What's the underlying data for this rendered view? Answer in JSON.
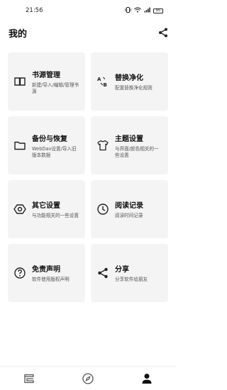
{
  "status_bar": {
    "time": "21:56",
    "battery": "85"
  },
  "header": {
    "title": "我的"
  },
  "cards": [
    {
      "icon": "book-icon",
      "title": "书源管理",
      "desc": "新建/导入/编辑/管理书源"
    },
    {
      "icon": "text-replace-icon",
      "title": "替换净化",
      "desc": "配置替换净化规则"
    },
    {
      "icon": "folder-icon",
      "title": "备份与恢复",
      "desc": "WebDav设置/导入旧版本数据"
    },
    {
      "icon": "shirt-icon",
      "title": "主题设置",
      "desc": "与界面/颜色相关的一些设置"
    },
    {
      "icon": "settings-hexagon-icon",
      "title": "其它设置",
      "desc": "与功能相关的一些设置"
    },
    {
      "icon": "clock-icon",
      "title": "阅读记录",
      "desc": "阅读时间记录"
    },
    {
      "icon": "help-circle-icon",
      "title": "免责声明",
      "desc": "软件使用版权声明"
    },
    {
      "icon": "share-icon",
      "title": "分享",
      "desc": "分享软件给朋友"
    }
  ],
  "bottom_nav": [
    {
      "icon": "bookshelf-icon"
    },
    {
      "icon": "compass-icon"
    },
    {
      "icon": "person-icon"
    }
  ],
  "colors": {
    "card_bg": "#f4f4f4",
    "text": "#111111",
    "desc": "#555555"
  }
}
